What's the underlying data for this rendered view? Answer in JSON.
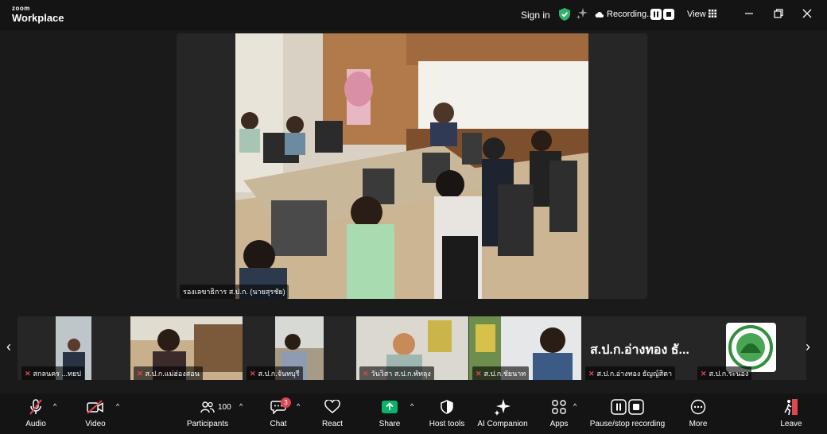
{
  "brand": {
    "line1": "zoom",
    "line2": "Workplace"
  },
  "topbar": {
    "sign_in": "Sign in",
    "recording_label": "Recording...",
    "view_label": "View"
  },
  "main_speaker": {
    "name": "รองเลขาธิการ ส.ป.ก. (นายสุรชัย)"
  },
  "gallery": {
    "tiles": [
      {
        "name": "สกลนคร ...ทยป"
      },
      {
        "name": "ส.ป.ก.แม่ฮ่องสอน"
      },
      {
        "name": "ส.ป.ก.จันทบุรี"
      },
      {
        "name": "วันวิสา ส.ป.ก.พัทลุง"
      },
      {
        "name": "ส.ป.ก.ชัยนาท"
      },
      {
        "name": "ส.ป.ก.อ่างทอง ธัญญ์สิตา",
        "display_text": "ส.ป.ก.อ่างทอง ธั..."
      },
      {
        "name": "ส.ป.ก.ระนอง"
      }
    ]
  },
  "toolbar": {
    "audio": "Audio",
    "video": "Video",
    "participants": "Participants",
    "participant_count": "100",
    "chat": "Chat",
    "chat_badge": "3",
    "react": "React",
    "share": "Share",
    "host_tools": "Host tools",
    "ai_companion": "AI Companion",
    "apps": "Apps",
    "pause_stop_recording": "Pause/stop recording",
    "more": "More",
    "leave": "Leave"
  },
  "colors": {
    "share_green": "#0bb26a",
    "leave_red": "#e0464e",
    "muted_red": "#e0464e",
    "shield_green": "#2fb36b"
  }
}
